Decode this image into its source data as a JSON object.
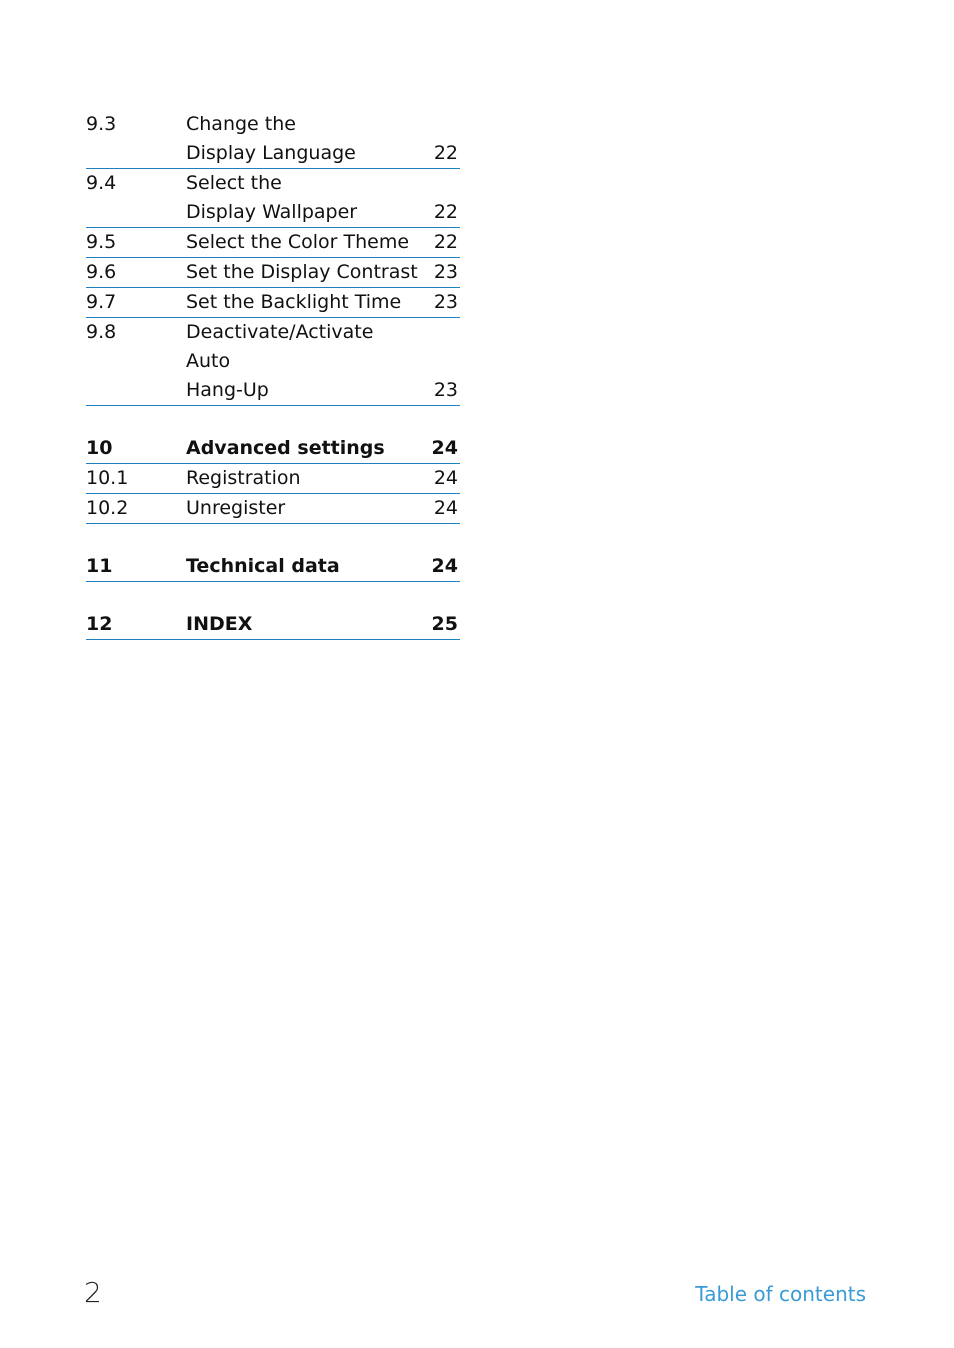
{
  "toc": {
    "entries": [
      {
        "num": "9.3",
        "title": "Change the\nDisplay Language",
        "page": "22",
        "bold": false
      },
      {
        "num": "9.4",
        "title": "Select the\nDisplay Wallpaper",
        "page": "22",
        "bold": false
      },
      {
        "num": "9.5",
        "title": "Select the Color Theme",
        "page": "22",
        "bold": false
      },
      {
        "num": "9.6",
        "title": "Set the Display Contrast",
        "page": "23",
        "bold": false
      },
      {
        "num": "9.7",
        "title": "Set the Backlight Time",
        "page": "23",
        "bold": false
      },
      {
        "num": "9.8",
        "title": "Deactivate/Activate Auto\nHang-Up",
        "page": "23",
        "bold": false
      },
      {
        "num": "10",
        "title": "Advanced settings",
        "page": "24",
        "bold": true
      },
      {
        "num": "10.1",
        "title": "Registration",
        "page": "24",
        "bold": false
      },
      {
        "num": "10.2",
        "title": "Unregister",
        "page": "24",
        "bold": false
      },
      {
        "num": "11",
        "title": "Technical data",
        "page": "24",
        "bold": true
      },
      {
        "num": "12",
        "title": "INDEX",
        "page": "25",
        "bold": true
      }
    ]
  },
  "footer": {
    "page_number": "2",
    "section_label": "Table of contents"
  },
  "colors": {
    "rule": "#1f7fbf",
    "footer_label": "#3a9bd5"
  }
}
